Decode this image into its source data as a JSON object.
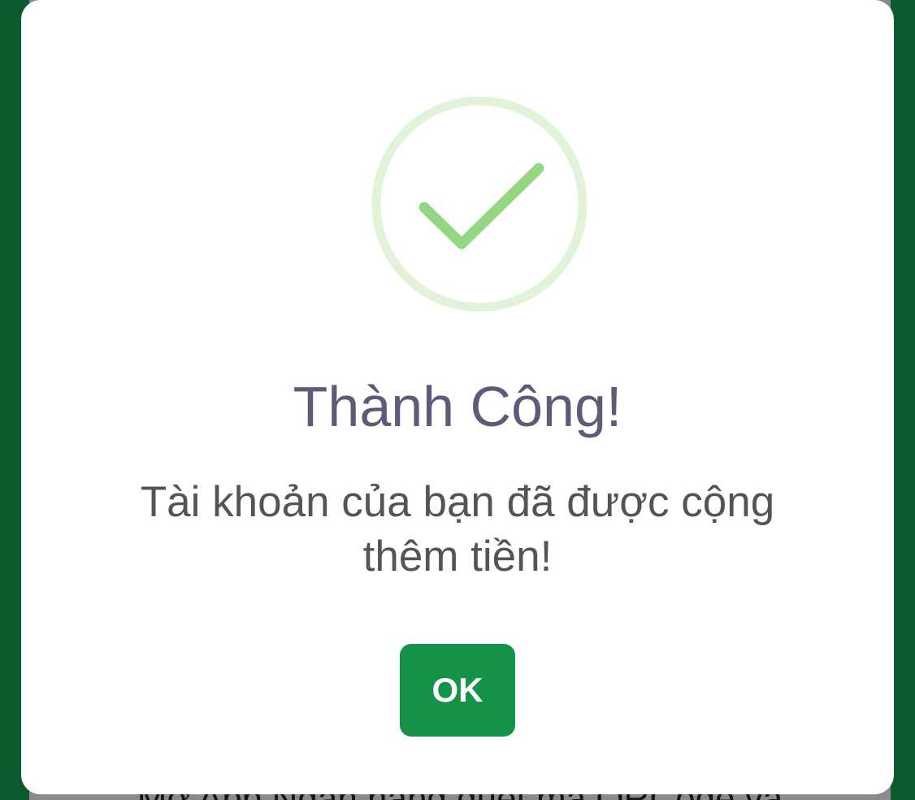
{
  "background": {
    "partial_text": "Mở App Ngân hàng quét mã QRCode và"
  },
  "dialog": {
    "icon": "check-circle-icon",
    "title": "Thành Công!",
    "message": "Tài khoản của bạn đã được cộng thêm tiền!",
    "ok_label": "OK"
  },
  "colors": {
    "page_background": "#0d5a2e",
    "dialog_background": "#ffffff",
    "icon_ring": "#e2f3da",
    "icon_check": "#94d682",
    "title_text": "#5e5a78",
    "message_text": "#545454",
    "ok_button": "#15924a",
    "ok_text": "#ffffff"
  }
}
